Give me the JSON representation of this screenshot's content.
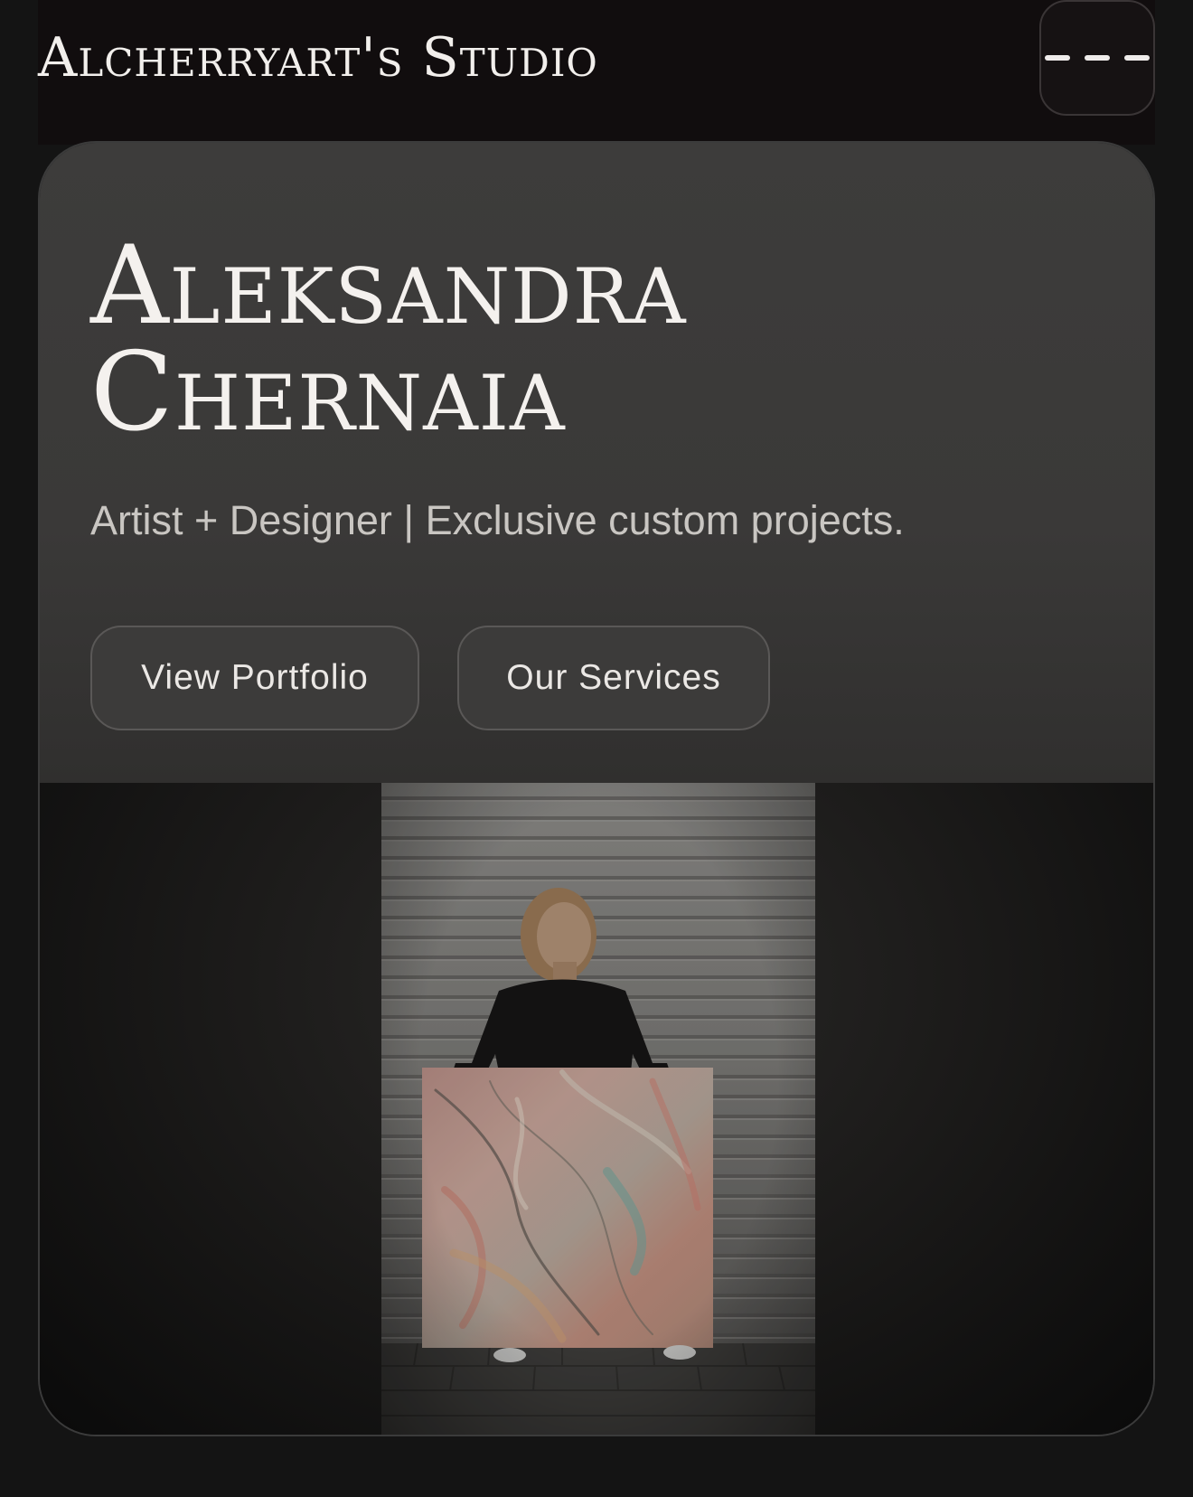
{
  "header": {
    "brand": "Alcherryart's Studio",
    "menu_icon": "menu-dashes-icon"
  },
  "hero": {
    "title_line1": "Aleksandra",
    "title_line2": "Chernaia",
    "tagline": "Artist + Designer | Exclusive custom projects.",
    "buttons": {
      "portfolio": "View Portfolio",
      "services": "Our Services"
    },
    "photo_icon": "artist-portrait-photo"
  },
  "colors": {
    "header_bg": "#110d0e",
    "hero_bg": "#3c3b3a",
    "text": "#f4f1ee",
    "page_bg": "#141414"
  }
}
